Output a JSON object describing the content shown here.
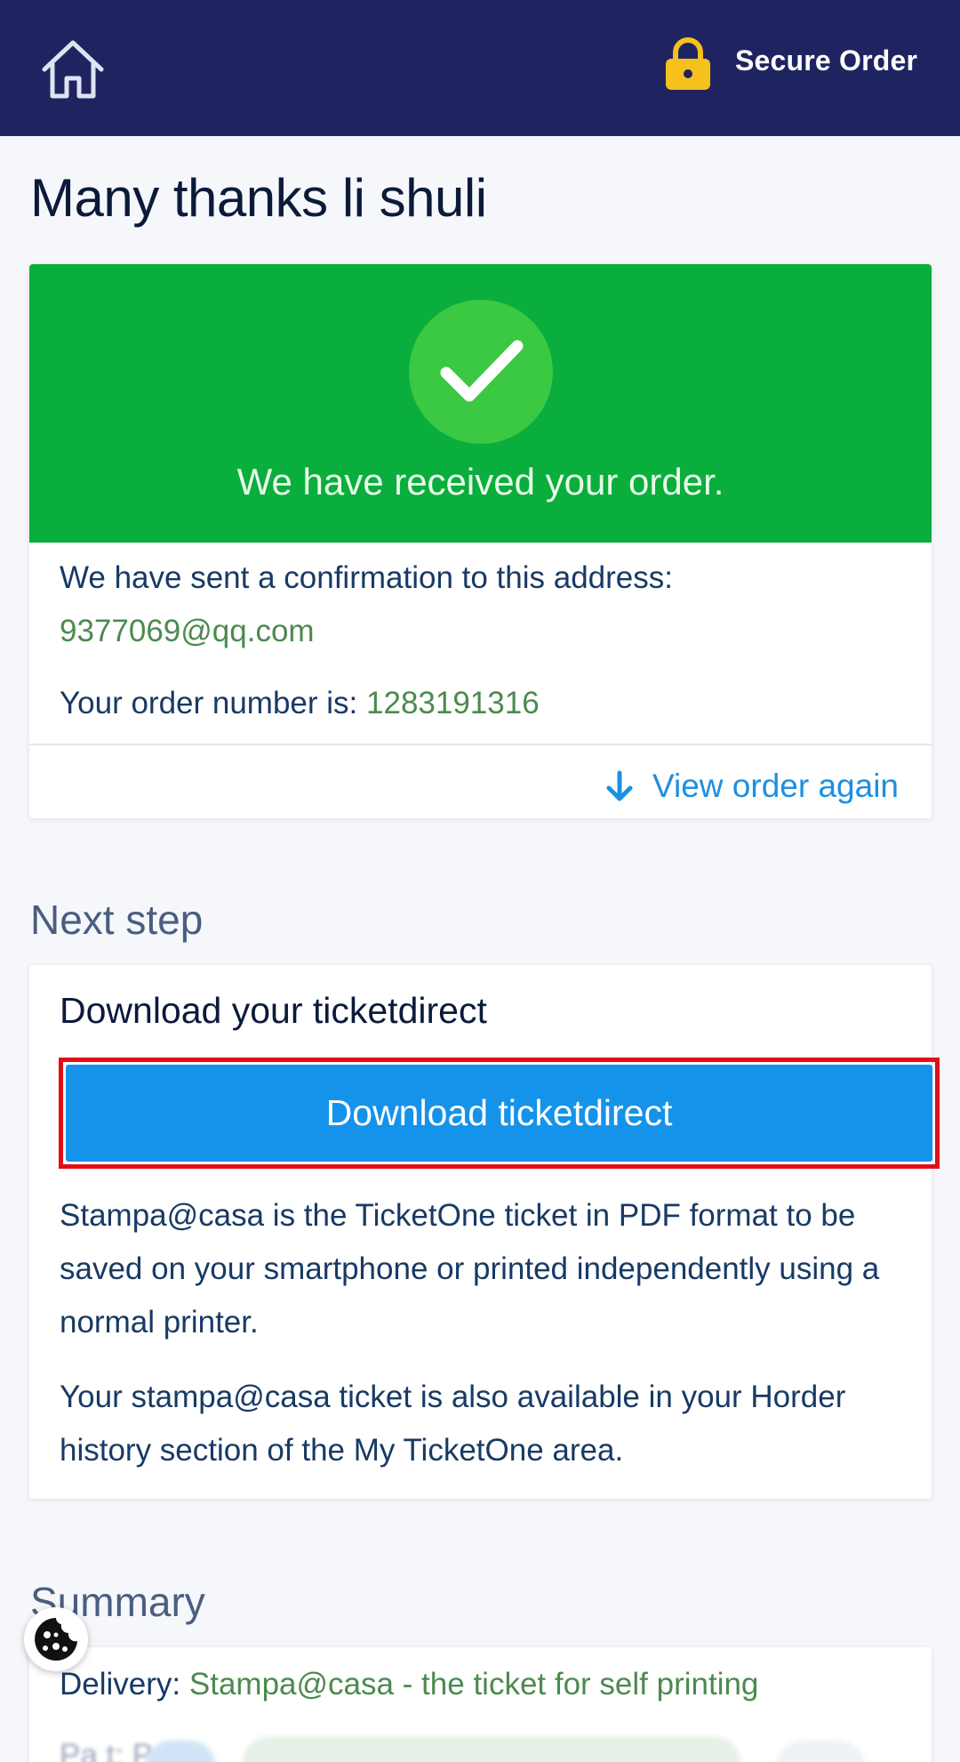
{
  "header": {
    "secure_label": "Secure Order",
    "icons": {
      "home": "home-icon",
      "lock": "lock-icon"
    },
    "colors": {
      "background": "#1f2461",
      "lock": "#f6c01d"
    }
  },
  "page_title": "Many thanks li shuli",
  "order_card": {
    "success_message": "We have received your order.",
    "confirmation_text": "We have sent a confirmation to this address:",
    "email": "9377069@qq.com",
    "order_number_label": "Your order number is:",
    "order_number": "1283191316",
    "view_order_label": "View order again",
    "icons": {
      "success": "check-icon",
      "view_order": "arrow-down-icon"
    },
    "colors": {
      "banner": "#0aae3c",
      "accent_text": "#4c8a4f",
      "link": "#1e8fe0"
    }
  },
  "next_step": {
    "section_title": "Next step",
    "heading": "Download your ticketdirect",
    "button_label": "Download ticketdirect",
    "paragraph_1": "Stampa@casa is the TicketOne ticket in PDF format to be saved on your smartphone or printed independently using a normal printer.",
    "paragraph_2": "Your stampa@casa ticket is also available in your Horder history section of the My TicketOne area.",
    "colors": {
      "button": "#1593ea",
      "highlight_border": "#e20d17"
    }
  },
  "summary": {
    "section_title": "Summary",
    "delivery_label": "Delivery:",
    "delivery_value": "Stampa@casa - the ticket for self printing",
    "obscured_row": "Pa      t: P"
  },
  "cookie_button": {
    "icon": "cookie-icon"
  }
}
